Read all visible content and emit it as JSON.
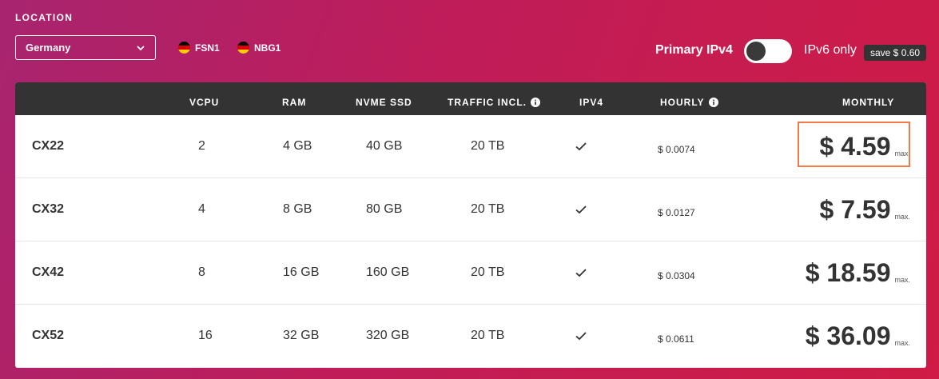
{
  "location": {
    "label": "LOCATION",
    "selected": "Germany",
    "datacenters": [
      "FSN1",
      "NBG1"
    ]
  },
  "ip": {
    "primary_label": "Primary IPv4",
    "ipv6_label": "IPv6 only",
    "save_badge": "save $ 0.60",
    "toggle_on": false
  },
  "table": {
    "headers": {
      "vcpu": "VCPU",
      "ram": "RAM",
      "ssd": "NVME SSD",
      "traffic": "TRAFFIC INCL.",
      "ipv4": "IPV4",
      "hourly": "HOURLY",
      "monthly": "MONTHLY"
    },
    "rows": [
      {
        "name": "CX22",
        "vcpu": "2",
        "ram": "4 GB",
        "ssd": "40 GB",
        "traffic": "20 TB",
        "hourly": "$ 0.0074",
        "monthly": "$ 4.59",
        "max": "max."
      },
      {
        "name": "CX32",
        "vcpu": "4",
        "ram": "8 GB",
        "ssd": "80 GB",
        "traffic": "20 TB",
        "hourly": "$ 0.0127",
        "monthly": "$ 7.59",
        "max": "max."
      },
      {
        "name": "CX42",
        "vcpu": "8",
        "ram": "16 GB",
        "ssd": "160 GB",
        "traffic": "20 TB",
        "hourly": "$ 0.0304",
        "monthly": "$ 18.59",
        "max": "max."
      },
      {
        "name": "CX52",
        "vcpu": "16",
        "ram": "32 GB",
        "ssd": "320 GB",
        "traffic": "20 TB",
        "hourly": "$ 0.0611",
        "monthly": "$ 36.09",
        "max": "max."
      }
    ]
  },
  "colors": {
    "bg_start": "#a8246f",
    "bg_end": "#cf1b45",
    "header_dark": "#333333",
    "highlight": "#ef7a4a"
  },
  "icons": {
    "dropdown": "chevron-down-icon",
    "flag": "germany-flag-icon",
    "info": "info-icon",
    "ipv4": "check-icon"
  }
}
